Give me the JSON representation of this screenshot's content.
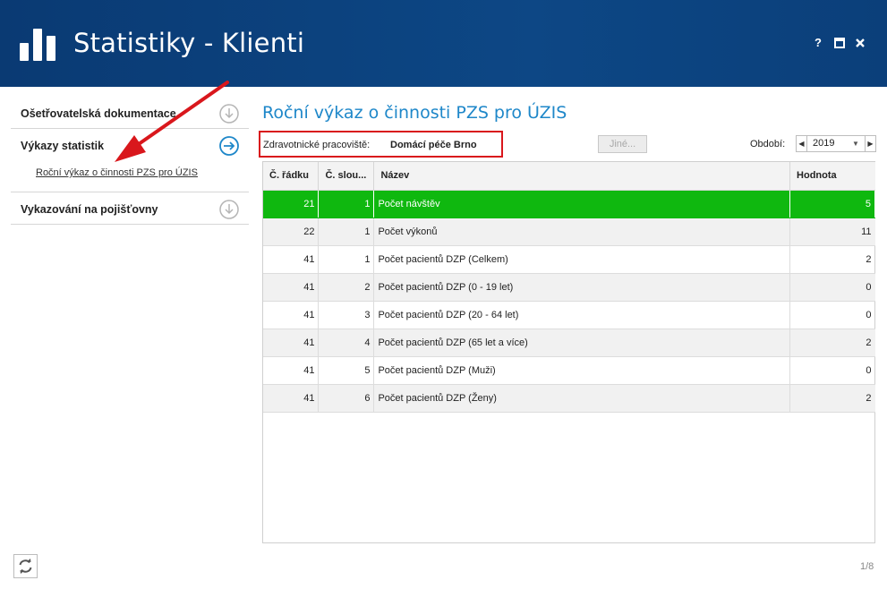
{
  "app": {
    "title": "Statistiky - Klienti",
    "help": "?"
  },
  "sidebar": {
    "items": [
      {
        "label": "Ošetřovatelská dokumentace",
        "icon": "arrow-down-circle-icon"
      },
      {
        "label": "Výkazy statistik",
        "icon": "arrow-right-circle-icon",
        "sub": "Roční výkaz o činnosti PZS pro ÚZIS"
      },
      {
        "label": "Vykazování na pojišťovny",
        "icon": "arrow-down-circle-icon"
      }
    ]
  },
  "main": {
    "title": "Roční výkaz o činnosti PZS pro ÚZIS",
    "filter": {
      "label": "Zdravotnické pracoviště:",
      "value": "Domácí péče Brno"
    },
    "other_button": "Jiné...",
    "period": {
      "label": "Období:",
      "year": "2019"
    },
    "table": {
      "headers": [
        "Č. řádku",
        "Č. slou...",
        "Název",
        "Hodnota"
      ],
      "rows": [
        {
          "r": "21",
          "s": "1",
          "name": "Počet návštěv",
          "val": "5"
        },
        {
          "r": "22",
          "s": "1",
          "name": "Počet výkonů",
          "val": "11"
        },
        {
          "r": "41",
          "s": "1",
          "name": "Počet pacientů DZP (Celkem)",
          "val": "2"
        },
        {
          "r": "41",
          "s": "2",
          "name": "Počet pacientů DZP (0 - 19 let)",
          "val": "0"
        },
        {
          "r": "41",
          "s": "3",
          "name": "Počet pacientů DZP (20 - 64 let)",
          "val": "0"
        },
        {
          "r": "41",
          "s": "4",
          "name": "Počet pacientů DZP (65 let a více)",
          "val": "2"
        },
        {
          "r": "41",
          "s": "5",
          "name": "Počet pacientů DZP (Muži)",
          "val": "0"
        },
        {
          "r": "41",
          "s": "6",
          "name": "Počet pacientů DZP (Ženy)",
          "val": "2"
        }
      ]
    },
    "pager": "1/8"
  },
  "colors": {
    "titlebar": "#0b3f7a",
    "accent": "#1e87c9",
    "selected_row": "#0fb80f",
    "highlight_box": "#d9171c"
  }
}
